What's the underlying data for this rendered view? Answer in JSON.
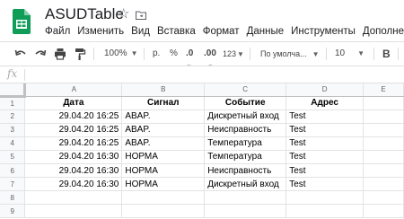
{
  "document": {
    "title": "ASUDTable"
  },
  "menu": [
    "Файл",
    "Изменить",
    "Вид",
    "Вставка",
    "Формат",
    "Данные",
    "Инструменты",
    "Дополнения"
  ],
  "toolbar": {
    "zoom": "100%",
    "currency": "р.",
    "percent": "%",
    "decrease_decimals": ".0",
    "increase_decimals": ".00",
    "more_formats": "123",
    "font_family": "По умолча...",
    "font_size": "10",
    "bold": "B"
  },
  "formula_bar": {
    "fx_label": "fx",
    "value": ""
  },
  "sheet": {
    "columns": [
      "A",
      "B",
      "C",
      "D",
      "E"
    ],
    "rows": [
      {
        "n": "1",
        "a": "Дата",
        "b": "Сигнал",
        "c": "Событие",
        "d": "Адрес",
        "e": ""
      },
      {
        "n": "2",
        "a": "29.04.20 16:25",
        "b": "ABAP.",
        "c": "Дискретный вход",
        "d": "Test",
        "e": ""
      },
      {
        "n": "3",
        "a": "29.04.20 16:25",
        "b": "ABAP.",
        "c": "Неисправность",
        "d": "Test",
        "e": ""
      },
      {
        "n": "4",
        "a": "29.04.20 16:25",
        "b": "ABAP.",
        "c": "Температура",
        "d": "Test",
        "e": ""
      },
      {
        "n": "5",
        "a": "29.04.20 16:30",
        "b": "НОРМА",
        "c": "Температура",
        "d": "Test",
        "e": ""
      },
      {
        "n": "6",
        "a": "29.04.20 16:30",
        "b": "НОРМА",
        "c": "Неисправность",
        "d": "Test",
        "e": ""
      },
      {
        "n": "7",
        "a": "29.04.20 16:30",
        "b": "НОРМА",
        "c": "Дискретный вход",
        "d": "Test",
        "e": ""
      },
      {
        "n": "8",
        "a": "",
        "b": "",
        "c": "",
        "d": "",
        "e": ""
      },
      {
        "n": "9",
        "a": "",
        "b": "",
        "c": "",
        "d": "",
        "e": ""
      }
    ]
  },
  "colors": {
    "sheets_green": "#0f9d58",
    "header_bg": "#f8f9fa",
    "grid_line": "#e2e3e3"
  }
}
